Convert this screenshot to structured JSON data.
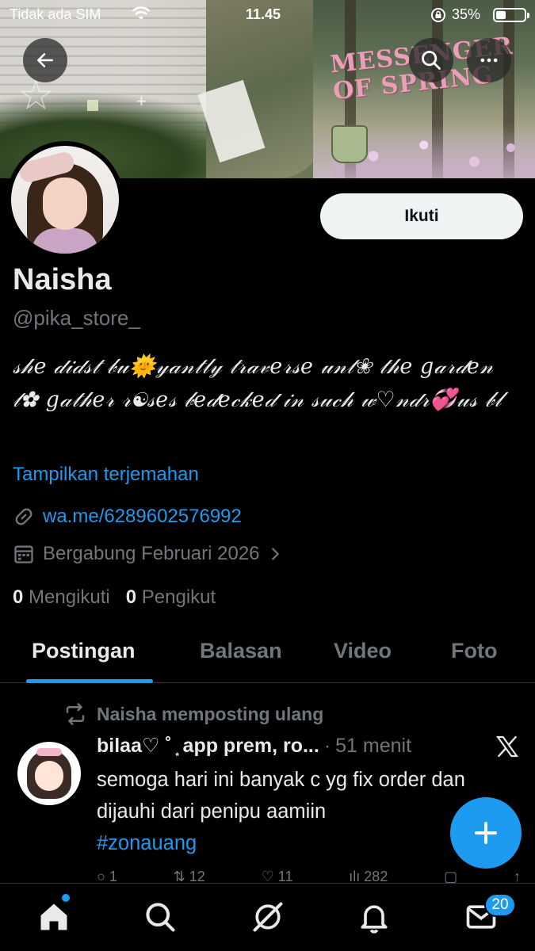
{
  "status_bar": {
    "carrier": "Tidak ada SIM",
    "time": "11.45",
    "battery_percent": "35%",
    "battery_level": 0.35
  },
  "header": {
    "back_icon": "arrow-left-icon",
    "search_icon": "search-icon",
    "more_icon": "more-horizontal-icon"
  },
  "banner": {
    "decor_text": "MESSENGER OF SPRING"
  },
  "profile": {
    "follow_label": "Ikuti",
    "display_name": "Naisha",
    "handle": "@pika_store_",
    "bio": "𝓈𝒽𝑒 𝒹𝒾𝒹𝓈𝓉 𝒷𝓊🌞𝓎𝒶𝓃𝓉𝓁𝓎 𝓉𝓇𝒶𝓋𝑒𝓇𝓈𝑒 𝓊𝓃𝓉❀ 𝓉𝒽𝑒 𝑔𝒶𝓇𝒹𝑒𝓃 𝓉✿ 𝑔𝒶𝓉𝒽𝑒𝓇 𝓇☯𝓈𝑒𝓈 𝒷𝑒𝒹𝑒𝒸𝓀𝑒𝒹 𝒾𝓃 𝓈𝓊𝒸𝒽 𝓌♡𝓃𝒹𝓇💞𝓊𝓈 𝒷𝓁",
    "translate_label": "Tampilkan terjemahan",
    "link": "wa.me/6289602576992",
    "joined": "Bergabung Februari 2026",
    "following_count": "0",
    "following_label": "Mengikuti",
    "followers_count": "0",
    "followers_label": "Pengikut"
  },
  "tabs": [
    {
      "label": "Postingan",
      "active": true
    },
    {
      "label": "Balasan",
      "active": false
    },
    {
      "label": "Video",
      "active": false
    },
    {
      "label": "Foto",
      "active": false
    }
  ],
  "post": {
    "repost_label": "Naisha memposting ulang",
    "author": "bilaa♡ ˚ ͙ app prem, ro...",
    "separator": "·",
    "time": "51 menit",
    "text": "semoga hari ini banyak c yg fix order dan dijauhi dari penipu aamiin",
    "hashtag": "#zonauang",
    "actions": {
      "replies": "1",
      "reposts": "12",
      "likes": "11",
      "views": "282"
    }
  },
  "fab": {
    "icon": "plus-icon"
  },
  "bottom_nav": {
    "items": [
      "home-icon",
      "search-icon",
      "grok-icon",
      "notifications-icon",
      "messages-icon"
    ],
    "messages_badge": "20"
  },
  "colors": {
    "accent": "#1d9bf0",
    "background": "#000000",
    "text_primary": "#e7e9ea",
    "text_secondary": "#71767b"
  }
}
